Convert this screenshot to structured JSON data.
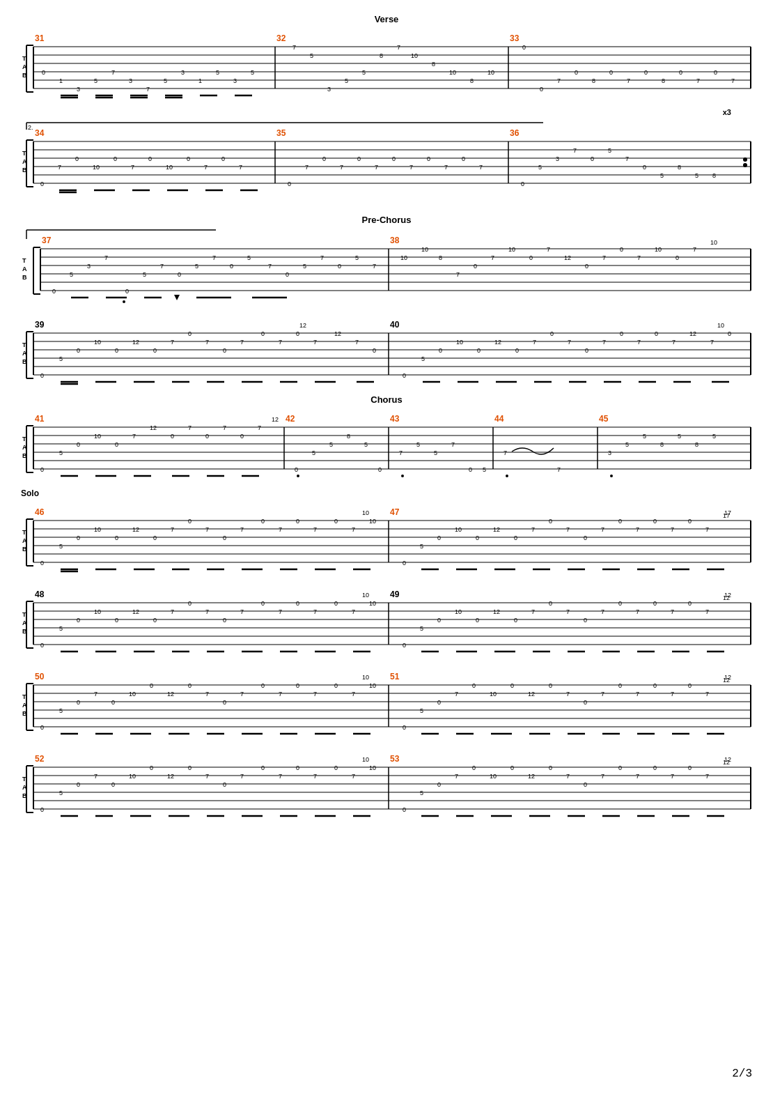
{
  "page": {
    "number": "2/3",
    "background": "#ffffff"
  },
  "sections": [
    {
      "label": "Verse",
      "show_label": true,
      "bars": [
        {
          "number": "31",
          "color": "#e05000"
        },
        {
          "number": "32",
          "color": "#e05000"
        },
        {
          "number": "33",
          "color": "#e05000"
        }
      ]
    },
    {
      "label": "",
      "show_label": false,
      "bars": [
        {
          "number": "34",
          "color": "#e05000"
        },
        {
          "number": "35",
          "color": "#e05000"
        },
        {
          "number": "36",
          "color": "#e05000"
        }
      ]
    },
    {
      "label": "Pre-Chorus",
      "show_label": true,
      "bars": [
        {
          "number": "37",
          "color": "#e05000"
        },
        {
          "number": "38",
          "color": "#e05000"
        }
      ]
    },
    {
      "label": "",
      "show_label": false,
      "bars": [
        {
          "number": "39",
          "color": "#000000"
        },
        {
          "number": "40",
          "color": "#000000"
        }
      ]
    },
    {
      "label": "Chorus",
      "show_label": true,
      "bars": [
        {
          "number": "41",
          "color": "#e05000"
        },
        {
          "number": "42",
          "color": "#e05000"
        },
        {
          "number": "43",
          "color": "#e05000"
        },
        {
          "number": "44",
          "color": "#e05000"
        },
        {
          "number": "45",
          "color": "#e05000"
        }
      ]
    },
    {
      "label": "Solo",
      "show_label": true,
      "bars": [
        {
          "number": "46",
          "color": "#e05000"
        },
        {
          "number": "47",
          "color": "#e05000"
        }
      ]
    },
    {
      "label": "",
      "show_label": false,
      "bars": [
        {
          "number": "48",
          "color": "#000000"
        },
        {
          "number": "49",
          "color": "#000000"
        }
      ]
    },
    {
      "label": "",
      "show_label": false,
      "bars": [
        {
          "number": "50",
          "color": "#e05000"
        },
        {
          "number": "51",
          "color": "#e05000"
        }
      ]
    },
    {
      "label": "",
      "show_label": false,
      "bars": [
        {
          "number": "52",
          "color": "#e05000"
        },
        {
          "number": "53",
          "color": "#e05000"
        }
      ]
    }
  ]
}
